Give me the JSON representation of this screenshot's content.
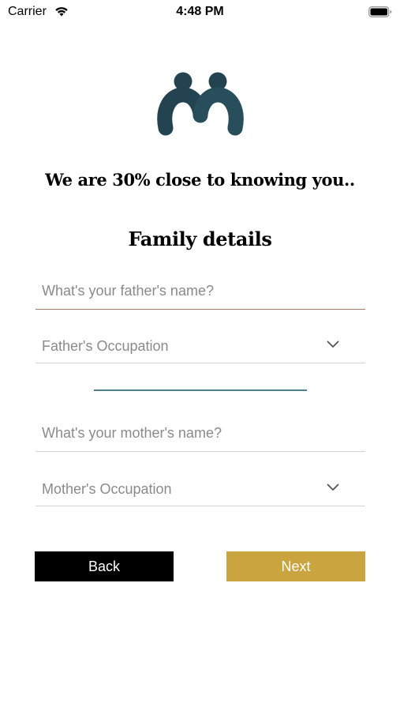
{
  "status_bar": {
    "carrier": "Carrier",
    "time": "4:48 PM",
    "wifi_icon": "wifi-icon",
    "battery_icon": "battery-icon"
  },
  "logo": {
    "icon": "two-people-logo-icon",
    "color": "#234350"
  },
  "tagline": "We are 30% close to knowing you..",
  "section_title": "Family details",
  "form": {
    "father_name_placeholder": "What's your father's name?",
    "father_name_value": "",
    "father_occupation_label": "Father's Occupation",
    "mother_name_placeholder": "What's your mother's name?",
    "mother_name_value": "",
    "mother_occupation_label": "Mother's Occupation",
    "chevron_icon": "chevron-down-icon"
  },
  "buttons": {
    "back_label": "Back",
    "next_label": "Next",
    "back_color": "#000000",
    "next_color": "#c9a43f"
  },
  "colors": {
    "divider": "#4e7f8c",
    "active_field_underline": "#a07b6b"
  }
}
